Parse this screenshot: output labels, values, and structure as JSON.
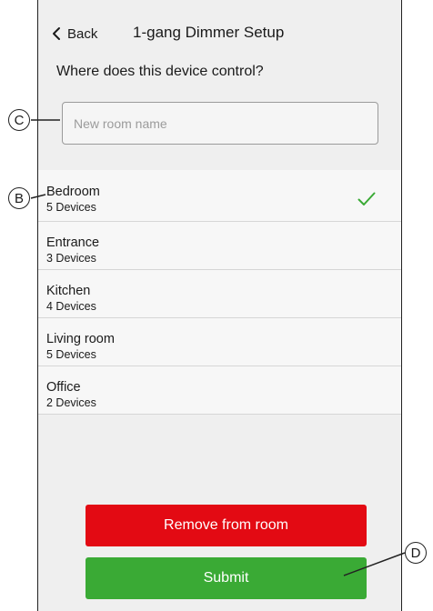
{
  "header": {
    "back_label": "Back",
    "title": "1-gang Dimmer Setup"
  },
  "question": "Where does this device control?",
  "room_input": {
    "value": "",
    "placeholder": "New room name"
  },
  "rooms": [
    {
      "name": "Bedroom",
      "devices": "5 Devices",
      "selected": true
    },
    {
      "name": "Entrance",
      "devices": "3 Devices",
      "selected": false
    },
    {
      "name": "Kitchen",
      "devices": "4 Devices",
      "selected": false
    },
    {
      "name": "Living room",
      "devices": "5 Devices",
      "selected": false
    },
    {
      "name": "Office",
      "devices": "2 Devices",
      "selected": false
    }
  ],
  "buttons": {
    "remove_label": "Remove from room",
    "submit_label": "Submit"
  },
  "callouts": {
    "input": "C",
    "room": "B",
    "submit": "D"
  },
  "colors": {
    "remove": "#e30a13",
    "submit": "#3aaa35",
    "check": "#3aaa35",
    "background": "#efefef"
  },
  "icons": {
    "back": "chevron-left-icon",
    "selected": "checkmark-icon"
  }
}
